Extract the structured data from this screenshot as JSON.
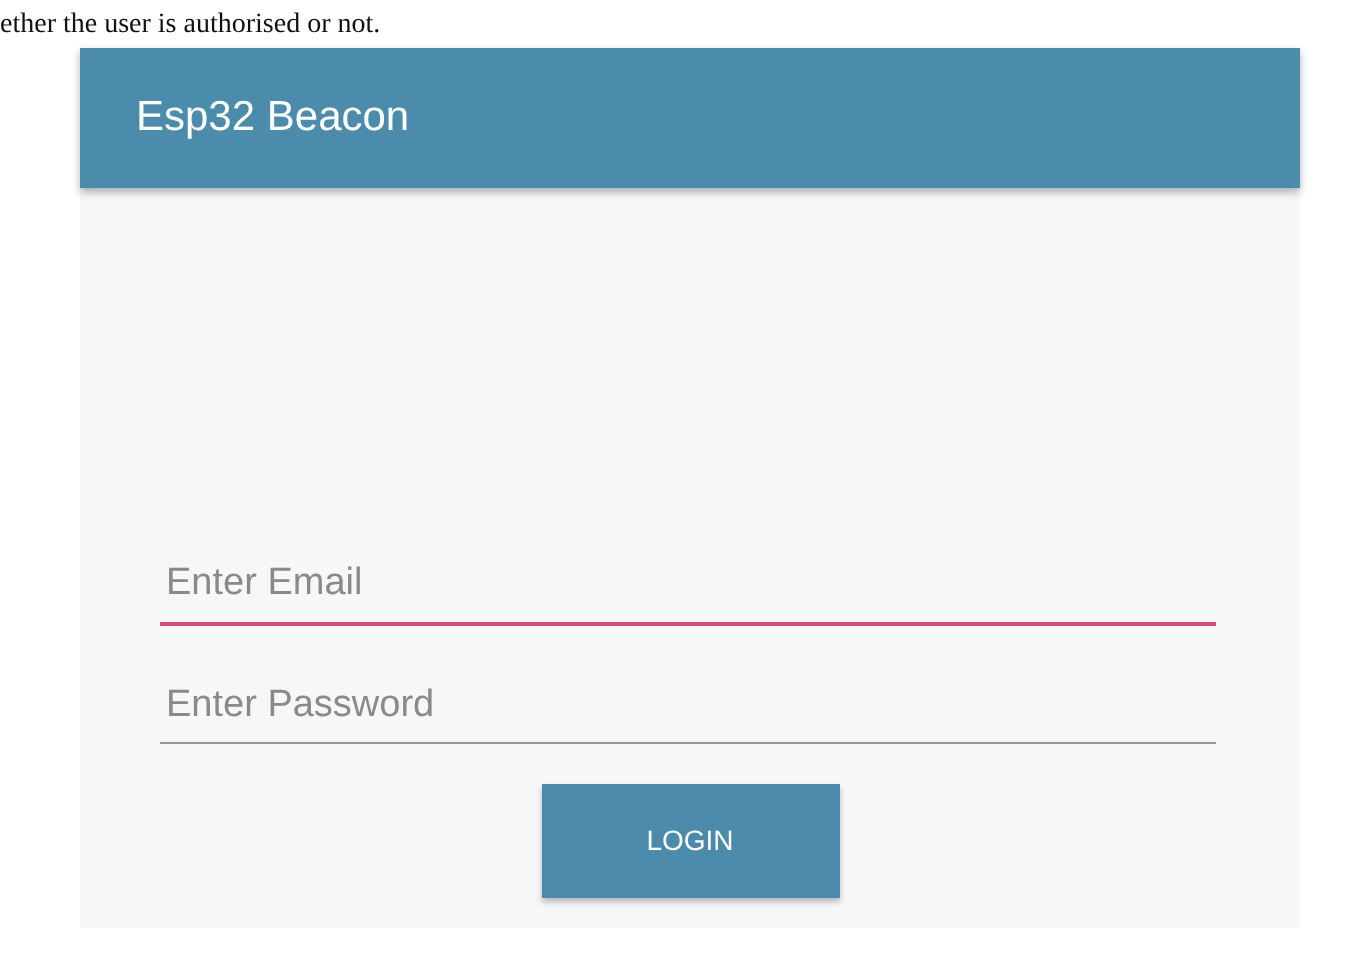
{
  "caption": "ether the user is authorised or not.",
  "app": {
    "title": "Esp32 Beacon",
    "fields": [
      {
        "placeholder": "Enter Email",
        "focused": true
      },
      {
        "placeholder": "Enter Password",
        "focused": false
      }
    ],
    "button": "LOGIN"
  }
}
